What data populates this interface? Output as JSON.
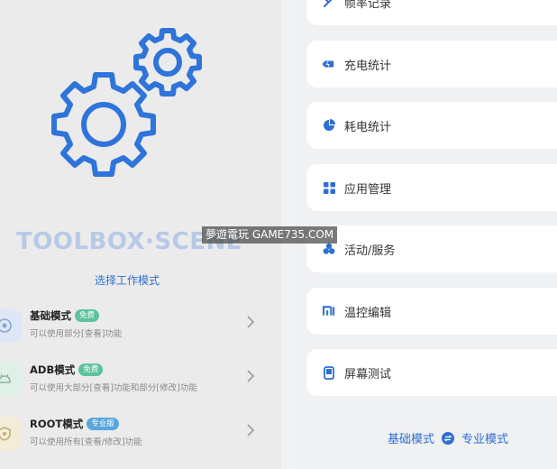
{
  "left": {
    "brand": "TOOLBOX·SCENE",
    "select_title": "选择工作模式",
    "modes": [
      {
        "title": "基础模式",
        "badge": "免费",
        "desc": "可以使用部分[查看]功能"
      },
      {
        "title": "ADB模式",
        "badge": "免费",
        "desc": "可以使用大部分[查看]功能和部分[修改]功能"
      },
      {
        "title": "ROOT模式",
        "badge": "专业版",
        "desc": "可以使用所有[查看/修改]功能"
      }
    ]
  },
  "right": {
    "items": [
      {
        "label": "帧率记录",
        "icon": "speed-icon"
      },
      {
        "label": "充电统计",
        "icon": "charging-icon"
      },
      {
        "label": "耗电统计",
        "icon": "pie-chart-icon"
      },
      {
        "label": "应用管理",
        "icon": "grid-icon"
      },
      {
        "label": "活动/服务",
        "icon": "activity-icon"
      },
      {
        "label": "温控编辑",
        "icon": "mi-icon"
      },
      {
        "label": "屏幕测试",
        "icon": "screen-icon"
      }
    ],
    "switch": {
      "left": "基础模式",
      "right": "专业模式"
    }
  },
  "watermark": "夢遊電玩 GAME735.COM",
  "colors": {
    "accent": "#2e6fd0",
    "badge_green": "#5cc39c",
    "badge_blue": "#5aa6dc"
  }
}
